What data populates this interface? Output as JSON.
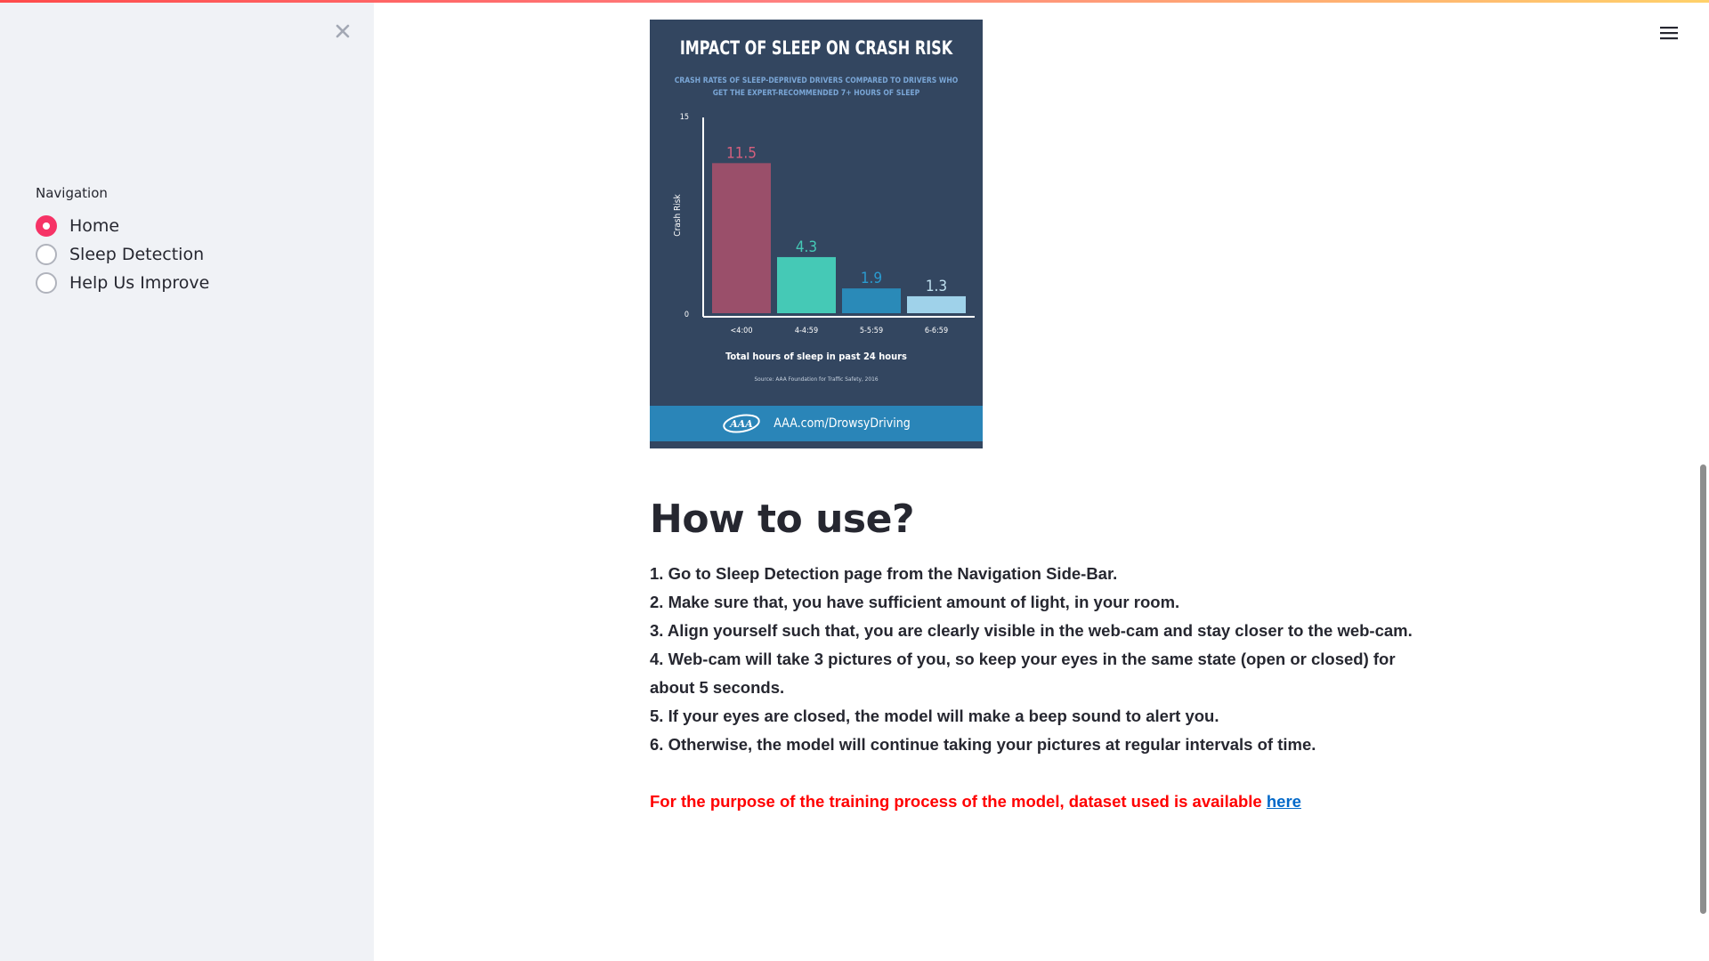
{
  "sidebar": {
    "nav_label": "Navigation",
    "options": [
      {
        "label": "Home",
        "selected": true
      },
      {
        "label": "Sleep Detection",
        "selected": false
      },
      {
        "label": "Help Us Improve",
        "selected": false
      }
    ]
  },
  "infographic": {
    "title": "IMPACT OF SLEEP ON CRASH RISK",
    "subtitle": "Crash rates of sleep-deprived drivers compared to drivers who get the expert-recommended 7+ hours of sleep",
    "footer": "AAA.com/DrowsyDriving",
    "logo": "AAA",
    "colors": {
      "bg": "#334660",
      "footer": "#2a85b8"
    },
    "chart_data": {
      "type": "bar",
      "categories": [
        "<4:00",
        "4-4:59",
        "5-5:59",
        "6-6:59"
      ],
      "values": [
        11.5,
        4.3,
        1.9,
        1.3
      ],
      "value_labels": [
        "11.5",
        "4.3",
        "1.9",
        "1.3"
      ],
      "colors": [
        "#9a4f6a",
        "#45c9b6",
        "#2a8ab8",
        "#9fd2ea"
      ],
      "label_colors": [
        "#d6607e",
        "#45c9b6",
        "#2a9bd0",
        "#bfe0f0"
      ],
      "ylabel": "Crash Risk",
      "xlabel": "Total hours of sleep in past 24 hours",
      "source": "Source: AAA Foundation for Traffic Safety, 2016",
      "ylim": [
        0,
        15
      ],
      "ytick_labels": [
        "15",
        "0"
      ]
    }
  },
  "main": {
    "heading": "How to use?",
    "steps": [
      "1. Go to Sleep Detection page from the Navigation Side-Bar.",
      "2. Make sure that, you have sufficient amount of light, in your room.",
      "3. Align yourself such that, you are clearly visible in the web-cam and stay closer to the web-cam.",
      "4. Web-cam will take 3 pictures of you, so keep your eyes in the same state (open or closed) for about 5 seconds.",
      "5. If your eyes are closed, the model will make a beep sound to alert you.",
      "6. Otherwise, the model will continue taking your pictures at regular intervals of time."
    ],
    "note_text": "For the purpose of the training process of the model, dataset used is available ",
    "note_link": "here",
    "colors": {
      "note": "#ff0000",
      "link": "#0068c9",
      "accent": "#f63366"
    }
  }
}
